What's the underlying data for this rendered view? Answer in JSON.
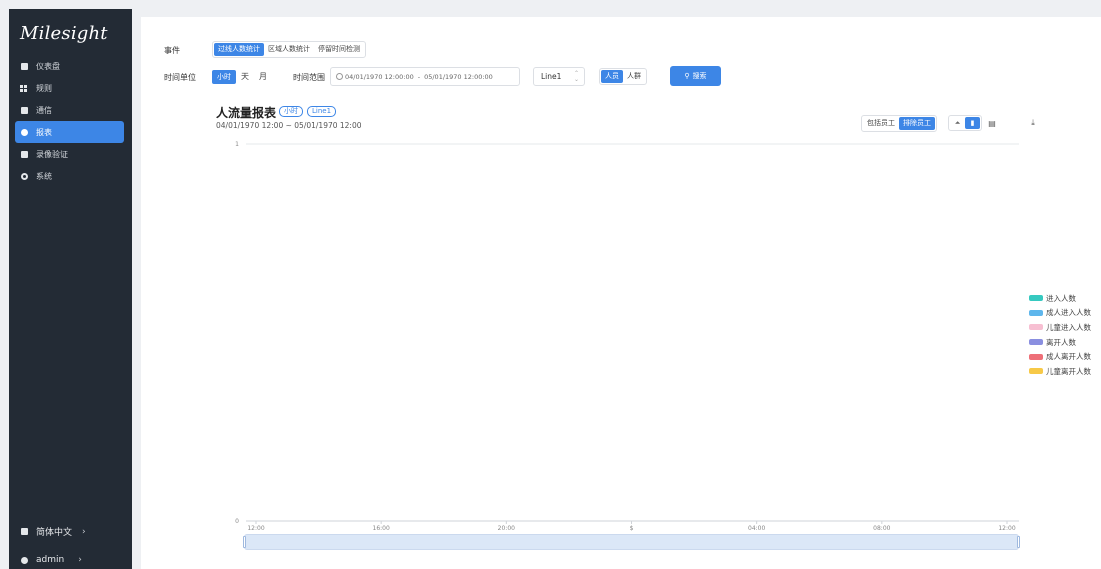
{
  "sidebar": {
    "logo": "Milesight",
    "items": [
      {
        "label": "仪表盘",
        "icon": "dashboard-icon",
        "active": false
      },
      {
        "label": "规则",
        "icon": "rules-icon",
        "active": false
      },
      {
        "label": "通信",
        "icon": "communication-icon",
        "active": false
      },
      {
        "label": "报表",
        "icon": "report-icon",
        "active": true
      },
      {
        "label": "录像验证",
        "icon": "video-icon",
        "active": false
      },
      {
        "label": "系统",
        "icon": "gear-icon",
        "active": false
      }
    ],
    "language": "简体中文",
    "user": "admin"
  },
  "filters": {
    "event_label": "事件",
    "event_options": [
      "过线人数统计",
      "区域人数统计",
      "停留时间检测"
    ],
    "unit_label": "时间单位",
    "unit_options": [
      "小时",
      "天",
      "月"
    ],
    "range_label": "时间范围",
    "range_start": "04/01/1970 12:00:00",
    "range_sep": "-",
    "range_end": "05/01/1970 12:00:00",
    "line_select": "Line1",
    "target_options": [
      "人员",
      "人群"
    ],
    "search_label": "搜索"
  },
  "report": {
    "title": "人流量报表",
    "tag_unit": "小时",
    "tag_line": "Line1",
    "subtitle": "04/01/1970 12:00 ~ 05/01/1970 12:00",
    "staff_options": [
      "包括员工",
      "排除员工"
    ]
  },
  "chart_data": {
    "type": "bar",
    "x": [
      "12:00",
      "16:00",
      "20:00",
      "$",
      "04:00",
      "08:00",
      "12:00"
    ],
    "ylim": [
      0,
      1
    ],
    "yticks": [
      "1",
      "0"
    ],
    "series": [
      {
        "name": "进入人数",
        "color": "#36c9c0",
        "values": []
      },
      {
        "name": "成人进入人数",
        "color": "#5eb6ec",
        "values": []
      },
      {
        "name": "儿童进入人数",
        "color": "#f7bfd2",
        "values": []
      },
      {
        "name": "离开人数",
        "color": "#8a8fe0",
        "values": []
      },
      {
        "name": "成人离开人数",
        "color": "#ee6f78",
        "values": []
      },
      {
        "name": "儿童离开人数",
        "color": "#f7c948",
        "values": []
      }
    ],
    "legend": "right"
  }
}
